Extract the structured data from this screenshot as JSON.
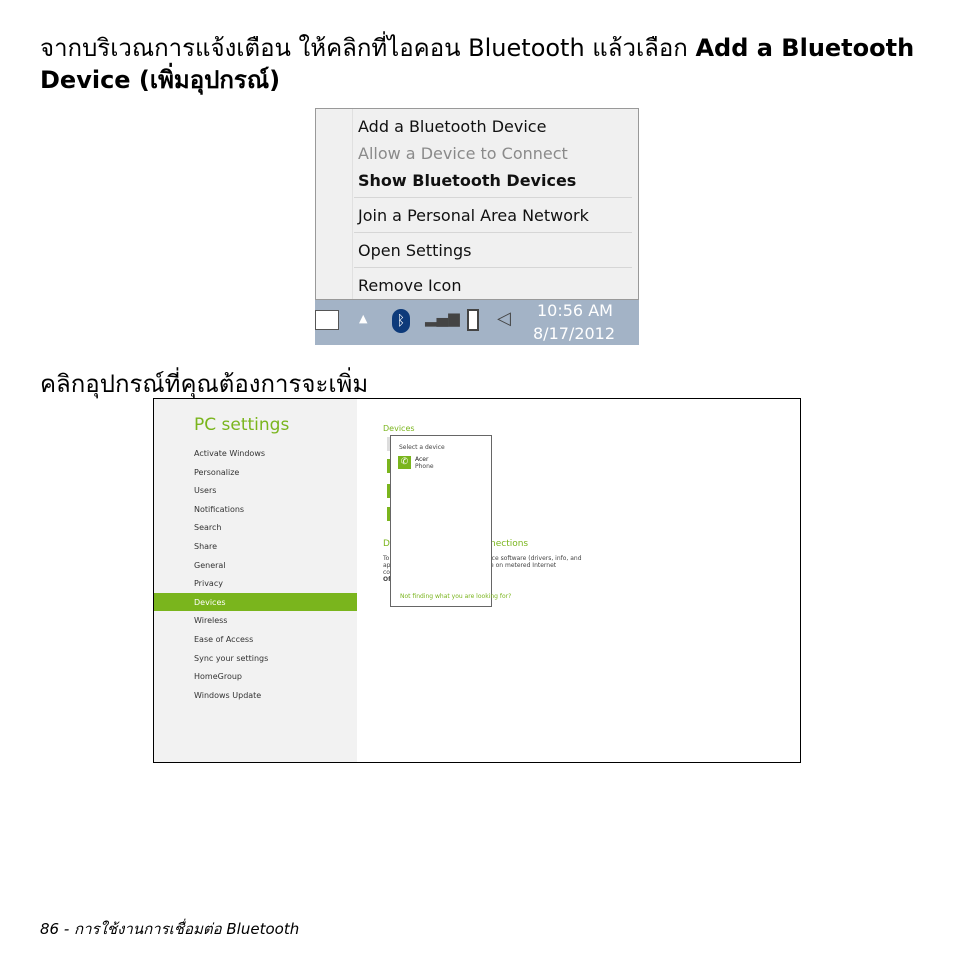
{
  "step1": {
    "text": "จากบริเวณการแจ้งเตือน ให้คลิกที่ไอคอน Bluetooth แล้วเลือก ",
    "bold": "Add a Bluetooth Device (เพิ่มอุปกรณ์)"
  },
  "context_menu": {
    "items": [
      "Add a Bluetooth Device",
      "Allow a Device to Connect",
      "Show Bluetooth Devices",
      "Join a Personal Area Network",
      "Open Settings",
      "Remove Icon"
    ]
  },
  "taskbar": {
    "time": "10:56 AM",
    "date": "8/17/2012",
    "icons": [
      "keyboard-icon",
      "show-hidden-icons-chevron",
      "bluetooth-icon",
      "network-signal-icon",
      "battery-icon",
      "volume-icon"
    ]
  },
  "step2": {
    "text": "คลิกอุปกรณ์ที่คุณต้องการจะเพิ่ม"
  },
  "pc_settings": {
    "title": "PC settings",
    "items": [
      "Activate Windows",
      "Personalize",
      "Users",
      "Notifications",
      "Search",
      "Share",
      "General",
      "Privacy",
      "Devices",
      "Wireless",
      "Ease of Access",
      "Sync your settings",
      "HomeGroup",
      "Windows Update"
    ],
    "selected": "Devices",
    "section": "Devices",
    "section2_left": "De",
    "section2_right": "nections",
    "para_left": [
      "To",
      "ap",
      "co",
      "Off"
    ],
    "para_right": [
      "ice software (drivers, info, and",
      "e on metered Internet"
    ],
    "popup": {
      "title": "Select a device",
      "device_name": "Acer",
      "device_type": "Phone",
      "link": "Not finding what you are looking for?"
    }
  },
  "accent": "#7ab51d",
  "footer": "86 - การใช้งานการเชื่อมต่อ Bluetooth"
}
